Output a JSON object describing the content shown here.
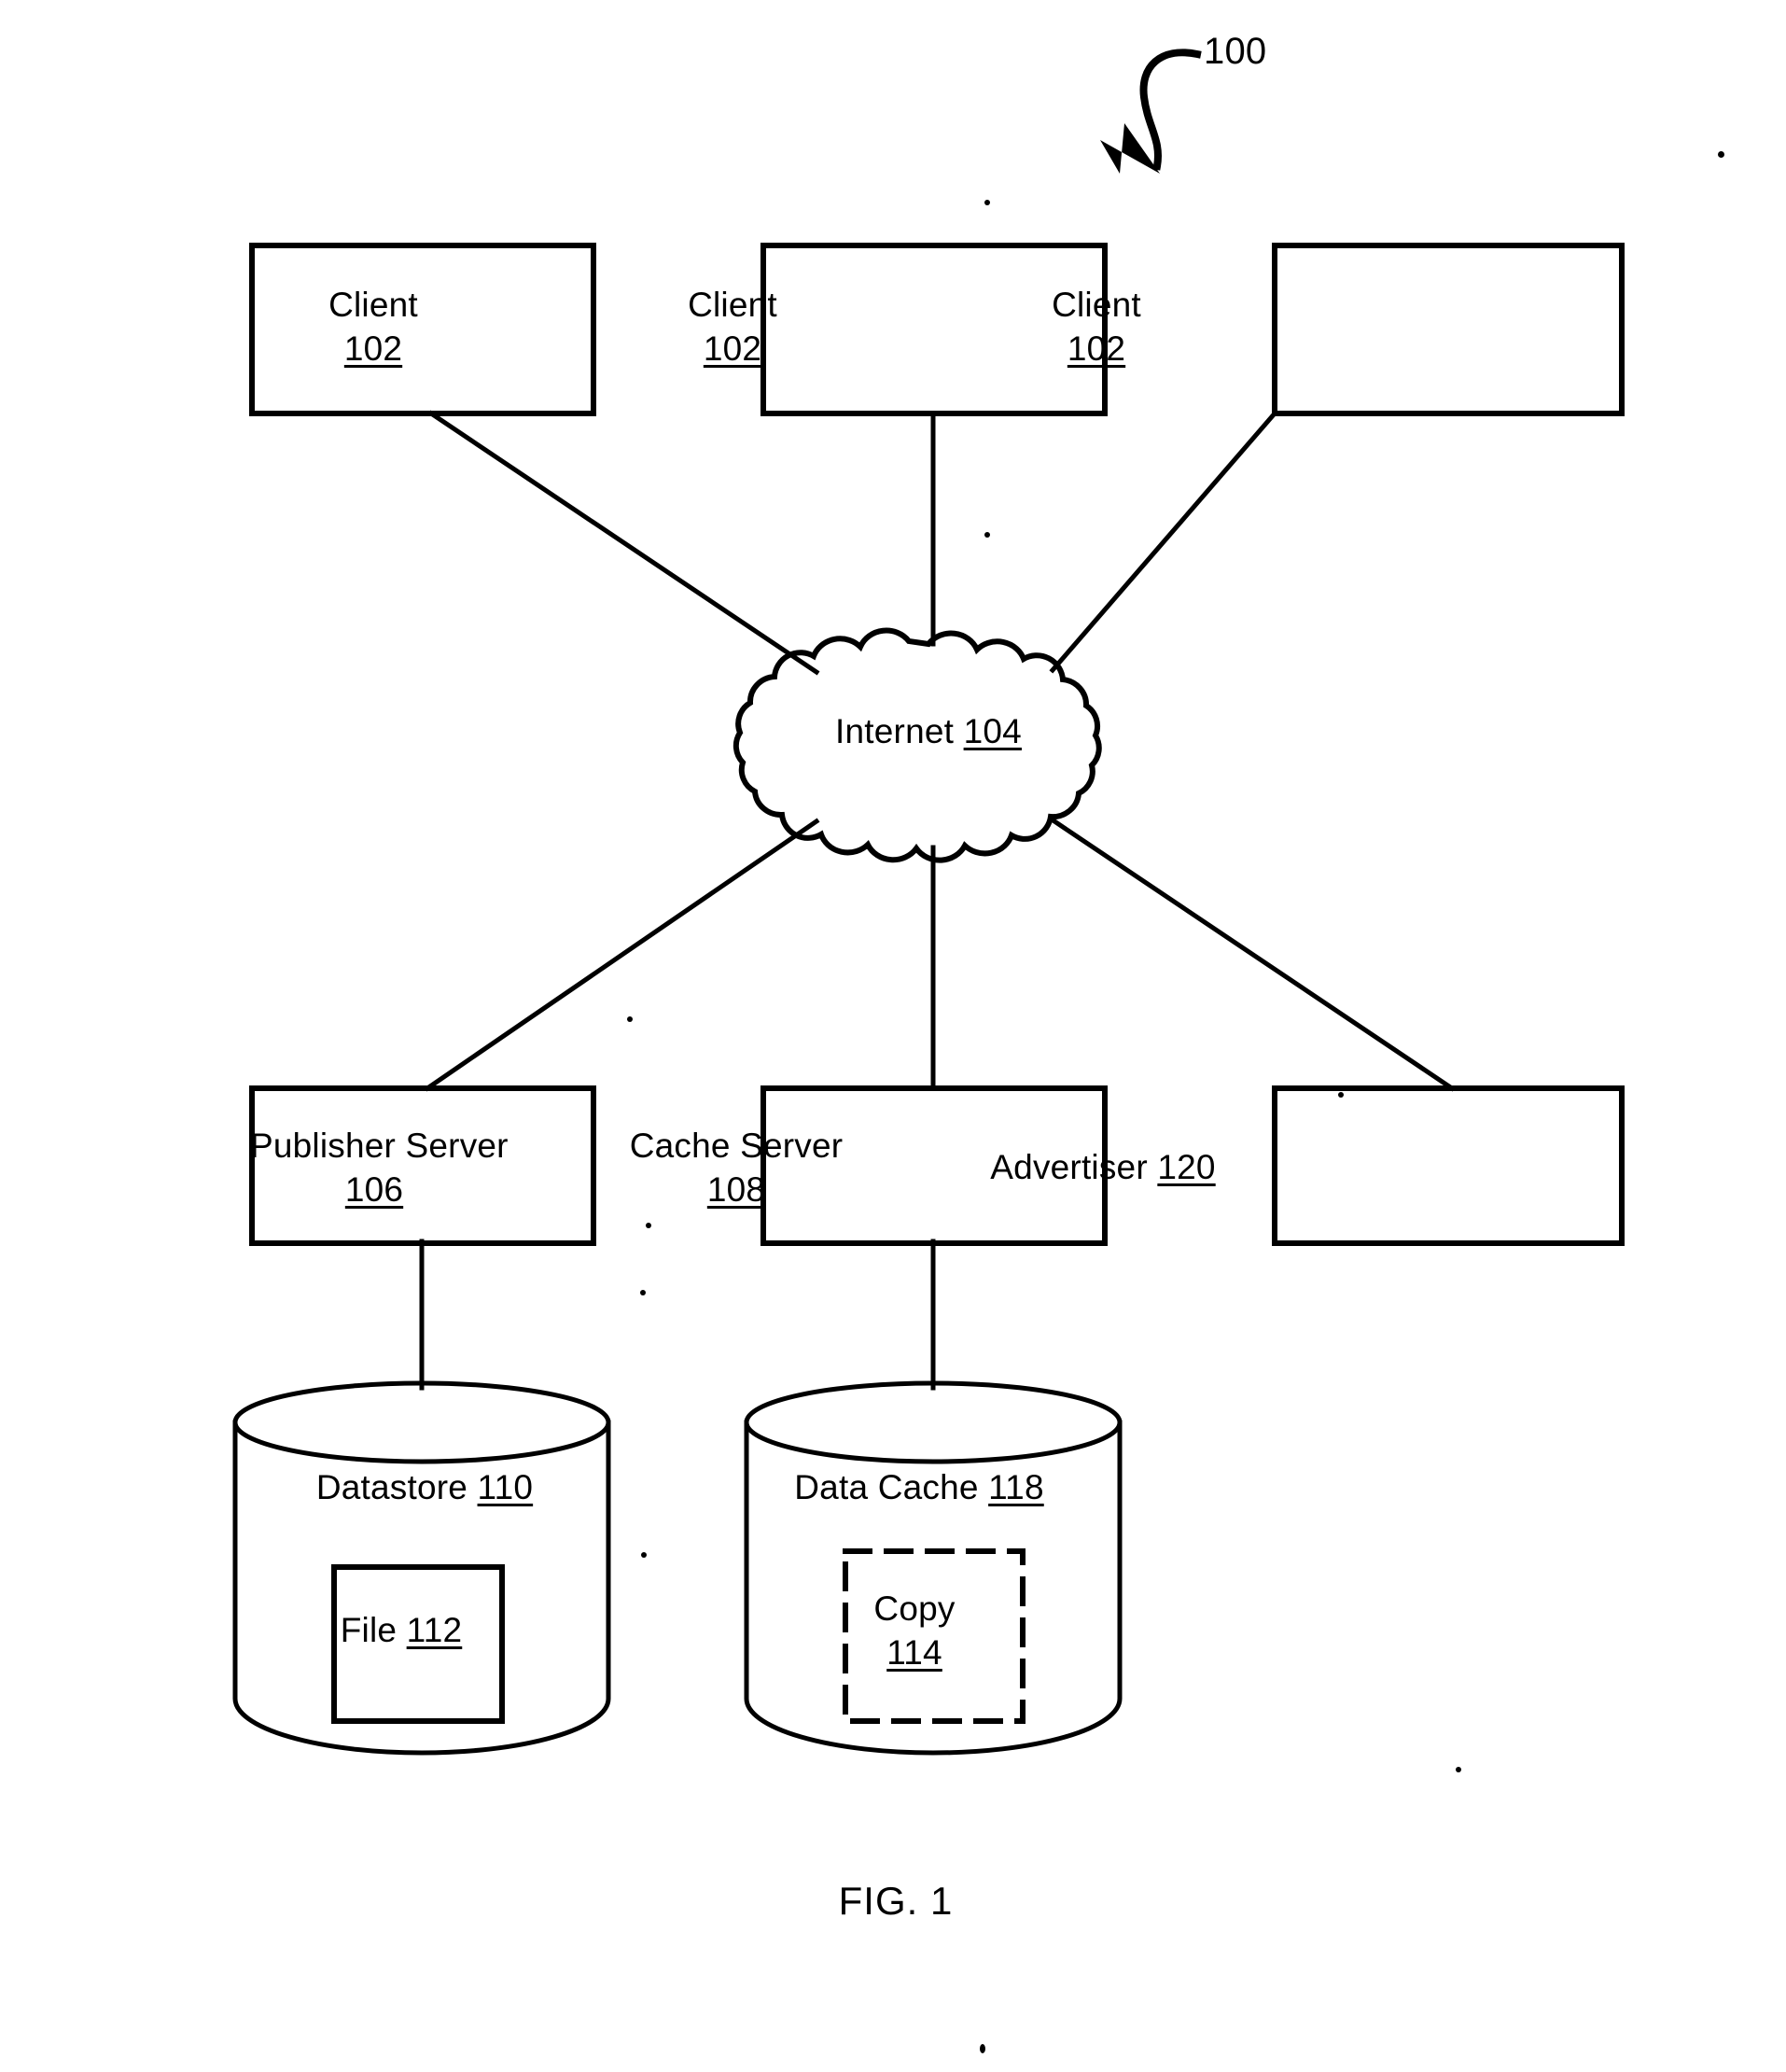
{
  "figure": {
    "caption": "FIG. 1",
    "reference_numeral": "100"
  },
  "nodes": {
    "clients": [
      {
        "name": "Client",
        "ref": "102"
      },
      {
        "name": "Client",
        "ref": "102"
      },
      {
        "name": "Client",
        "ref": "102"
      }
    ],
    "network": {
      "name": "Internet",
      "ref": "104",
      "shape": "cloud"
    },
    "publisher_server": {
      "name": "Publisher Server",
      "ref": "106",
      "shape": "rectangle"
    },
    "cache_server": {
      "name": "Cache Server",
      "ref": "108",
      "shape": "rectangle"
    },
    "advertiser": {
      "name": "Advertiser",
      "ref": "120",
      "shape": "rectangle"
    },
    "datastore": {
      "name": "Datastore",
      "ref": "110",
      "shape": "cylinder"
    },
    "data_cache": {
      "name": "Data Cache",
      "ref": "118",
      "shape": "cylinder"
    },
    "file": {
      "name": "File",
      "ref": "112",
      "shape": "solid-rectangle"
    },
    "copy": {
      "name": "Copy",
      "ref": "114",
      "shape": "dashed-rectangle"
    }
  },
  "connections": [
    {
      "from": "Client 102 (left)",
      "to": "Internet 104"
    },
    {
      "from": "Client 102 (center)",
      "to": "Internet 104"
    },
    {
      "from": "Client 102 (right)",
      "to": "Internet 104"
    },
    {
      "from": "Internet 104",
      "to": "Publisher Server 106"
    },
    {
      "from": "Internet 104",
      "to": "Cache Server 108"
    },
    {
      "from": "Internet 104",
      "to": "Advertiser 120"
    },
    {
      "from": "Publisher Server 106",
      "to": "Datastore 110"
    },
    {
      "from": "Cache Server 108",
      "to": "Data Cache 118"
    }
  ],
  "colors": {
    "stroke": "#000000",
    "background": "#ffffff"
  }
}
